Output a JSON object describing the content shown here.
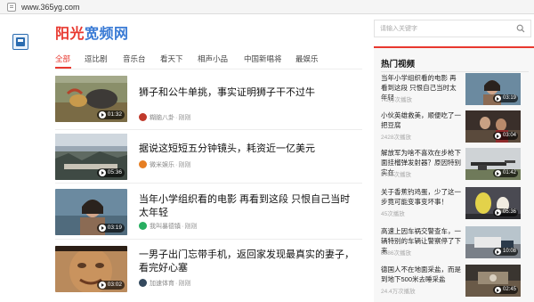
{
  "browser": {
    "url": "www.365yg.com"
  },
  "site": {
    "logo_part1": "阳光",
    "logo_part2": "宽频网"
  },
  "search": {
    "placeholder": "请输入关键字"
  },
  "tabs": [
    "全部",
    "逗比剧",
    "音乐台",
    "看天下",
    "相声小品",
    "中国新唱将",
    "最娱乐"
  ],
  "feed": [
    {
      "title": "狮子和公牛单挑，事实证明狮子干不过牛",
      "duration": "01:32",
      "source": "糊脑八卦",
      "time": "刚刚",
      "avatar_color": "#c0392b"
    },
    {
      "title": "据说这短短五分钟镜头，耗资近一亿美元",
      "duration": "05:36",
      "source": "微米娱乐",
      "time": "刚刚",
      "avatar_color": "#e67e22"
    },
    {
      "title": "当年小学组织看的电影 再看到这段 只恨自己当时太年轻",
      "duration": "03:19",
      "source": "我叫暴德镇",
      "time": "刚刚",
      "avatar_color": "#27ae60"
    },
    {
      "title": "一男子出门忘带手机，返回家发现最真实的妻子，看完好心塞",
      "duration": "03:02",
      "source": "加速体育",
      "time": "刚刚",
      "avatar_color": "#34495e"
    }
  ],
  "sidebar": {
    "title": "热门视频",
    "items": [
      {
        "title": "当年小学组织看的电影 再看到这段 只恨自己当时太年轻",
        "views": "7.2万次播放",
        "duration": "03:19"
      },
      {
        "title": "小伙英雄救美，顺便吃了一把豆腐",
        "views": "2428次播放",
        "duration": "03:04"
      },
      {
        "title": "解放军为啥不喜欢在步枪下面挂榴弹发射器？原因特别实在",
        "views": "5788次播放",
        "duration": "01:42"
      },
      {
        "title": "关于香蕉钓鸡蛋，少了这一步竟可能变事变坏事！",
        "views": "45次播放",
        "duration": "05:36"
      },
      {
        "title": "高速上因车祸交警查车，一辆特别的车辆让警察停了下来",
        "views": "3286次播放",
        "duration": "10:08"
      },
      {
        "title": "德国人不在地面采盐，而是到地下500米去睡采盐",
        "views": "24.4万次播放",
        "duration": "02:45"
      }
    ]
  },
  "colors": {
    "accent": "#e8382f",
    "logo_blue": "#3a7bd5"
  }
}
